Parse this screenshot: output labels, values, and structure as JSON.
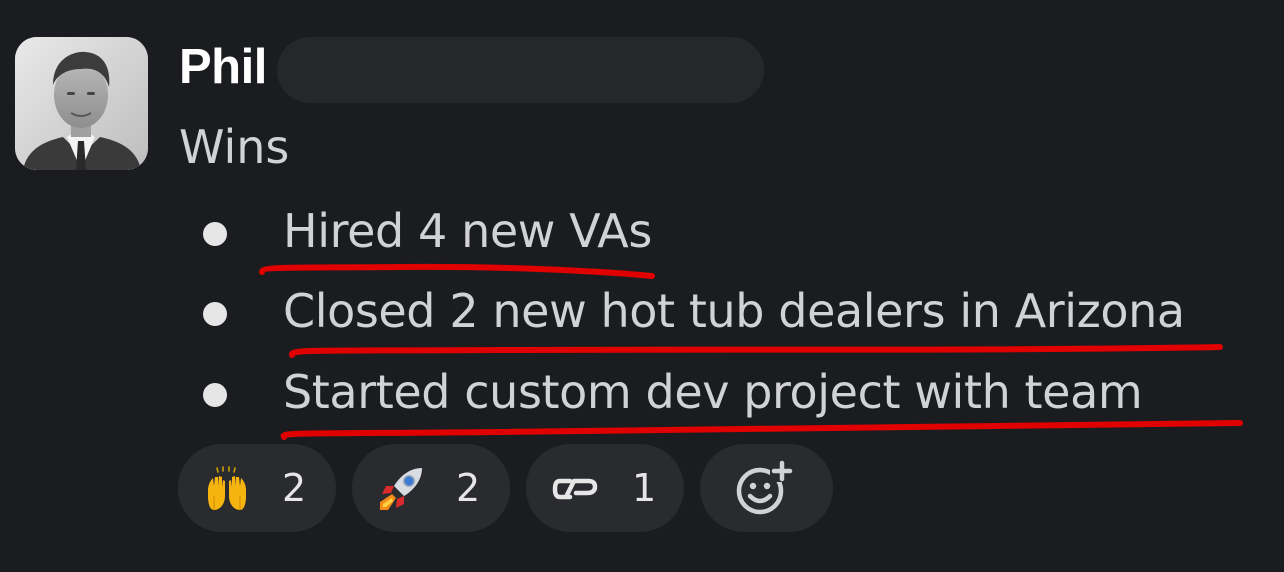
{
  "message": {
    "author": "Phil",
    "title": "Wins",
    "bullets": [
      "Hired 4 new VAs",
      "Closed 2 new hot tub dealers in Arizona",
      "Started custom dev project with team"
    ]
  },
  "reactions": [
    {
      "icon": "raising-hands-icon",
      "count": "2"
    },
    {
      "icon": "rocket-icon",
      "count": "2"
    },
    {
      "icon": "custom-cp-emoji-icon",
      "count": "1"
    },
    {
      "icon": "add-reaction-icon",
      "count": null
    }
  ],
  "colors": {
    "background": "#1b1c20",
    "text": "#d1d2d3",
    "author": "#ffffff",
    "pill": "#2a2b2f",
    "annotation": "#e00000"
  }
}
